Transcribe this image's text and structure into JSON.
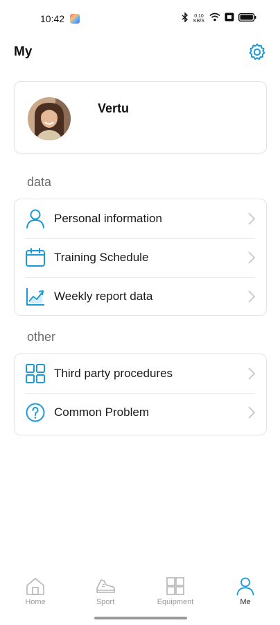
{
  "status_bar": {
    "time": "10:42",
    "network_speed_top": "0.10",
    "network_speed_bottom": "KB/S"
  },
  "header": {
    "title": "My"
  },
  "profile": {
    "name": "Vertu"
  },
  "sections": {
    "data_title": "data",
    "data_items": [
      {
        "label": "Personal information",
        "icon": "user-icon"
      },
      {
        "label": "Training Schedule",
        "icon": "calendar-icon"
      },
      {
        "label": "Weekly report data",
        "icon": "trend-chart-icon"
      }
    ],
    "other_title": "other",
    "other_items": [
      {
        "label": "Third party procedures",
        "icon": "grid-icon"
      },
      {
        "label": "Common Problem",
        "icon": "question-icon"
      }
    ]
  },
  "tab_bar": {
    "tabs": [
      {
        "label": "Home",
        "icon": "home-icon",
        "active": false
      },
      {
        "label": "Sport",
        "icon": "shoe-icon",
        "active": false
      },
      {
        "label": "Equipment",
        "icon": "device-grid-icon",
        "active": false
      },
      {
        "label": "Me",
        "icon": "person-icon",
        "active": true
      }
    ]
  },
  "colors": {
    "accent": "#1a9bd7",
    "inactive_icon": "#b5b5b5",
    "card_border": "#e3e3e3",
    "section_title": "#6b6b6b"
  }
}
